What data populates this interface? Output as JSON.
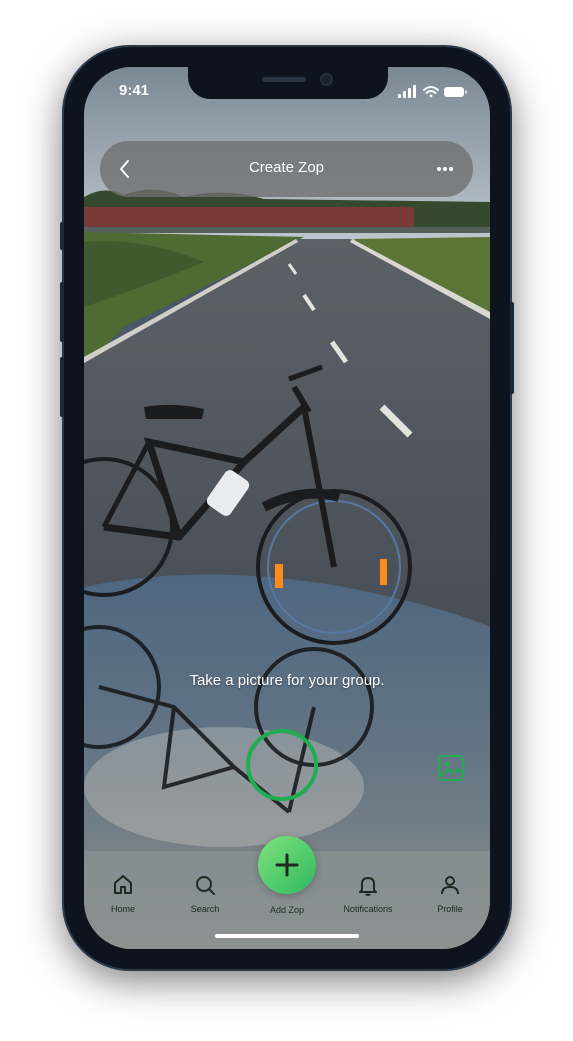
{
  "status": {
    "time": "9:41"
  },
  "header": {
    "title": "Create Zop"
  },
  "camera": {
    "hint": "Take a picture for your group."
  },
  "tabbar": {
    "items": [
      {
        "label": "Home",
        "icon": "home-icon"
      },
      {
        "label": "Search",
        "icon": "search-icon"
      },
      {
        "label": "Add Zop",
        "icon": "plus-icon"
      },
      {
        "label": "Notifications",
        "icon": "bell-icon"
      },
      {
        "label": "Profile",
        "icon": "user-icon"
      }
    ]
  },
  "colors": {
    "accent": "#1fae4f",
    "fab_start": "#7fe27b",
    "fab_end": "#2fb960"
  }
}
